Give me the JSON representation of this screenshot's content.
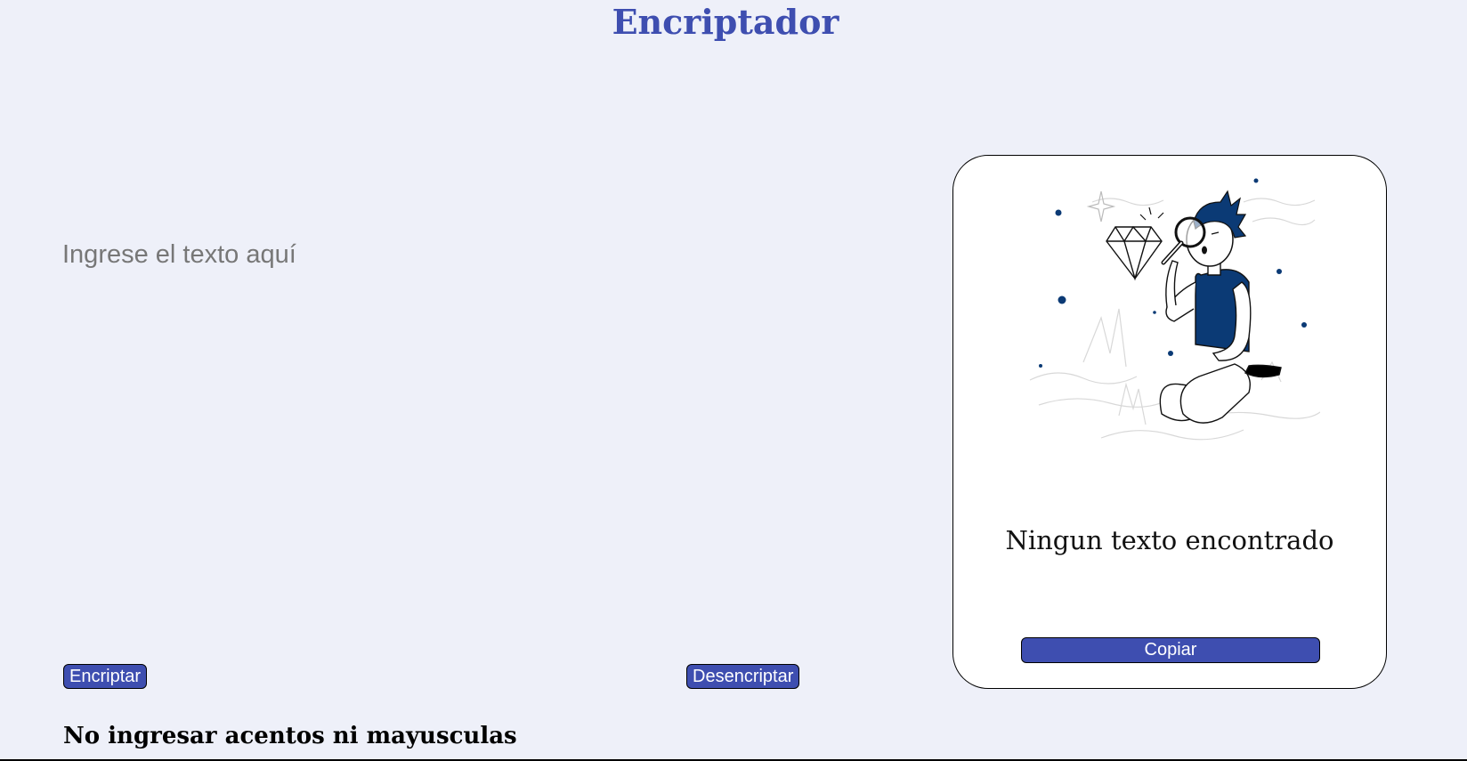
{
  "header": {
    "title": "Encriptador"
  },
  "input": {
    "placeholder": "Ingrese el texto aquí",
    "value": ""
  },
  "actions": {
    "encrypt_label": "Encriptar",
    "decrypt_label": "Desencriptar"
  },
  "warning": {
    "text": "No ingresar acentos ni mayusculas"
  },
  "result": {
    "empty_message": "Ningun texto encontrado",
    "copy_label": "Copiar",
    "illustration": "person-with-magnifying-glass-searching-diamond"
  },
  "colors": {
    "background": "#eef0f9",
    "accent": "#3e4eb0",
    "figure": "#0b3a75"
  }
}
